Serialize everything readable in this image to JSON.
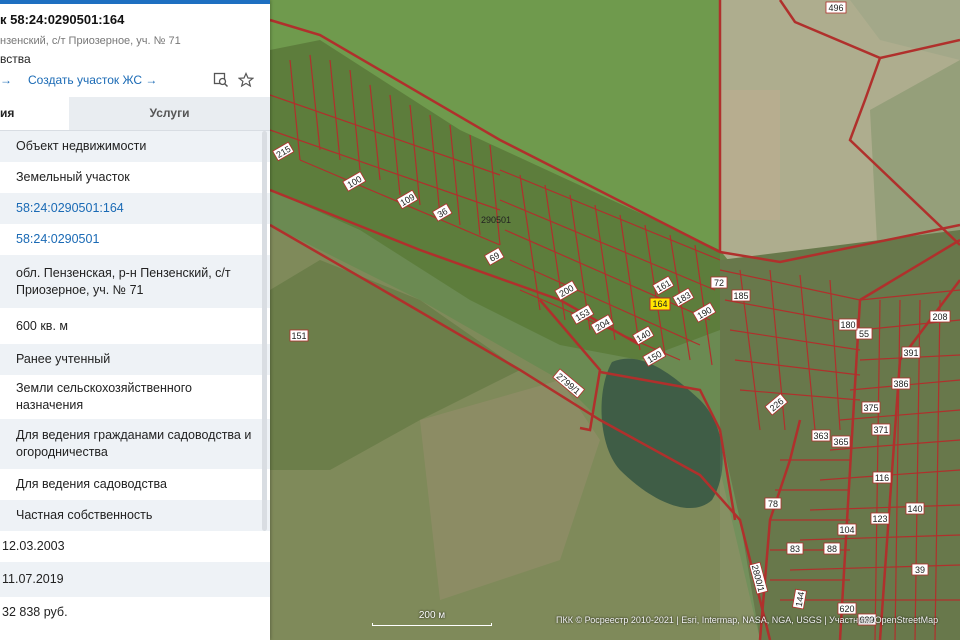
{
  "panel": {
    "title": "к 58:24:0290501:164",
    "subtitle": "нзенский, с/т Приозерное, уч. № 71",
    "category": "вства",
    "link_prefix": "→",
    "create_link": "Создать участок ЖС →",
    "tabs": [
      "ия",
      "Услуги"
    ],
    "rows": [
      "Объект недвижимости",
      "Земельный участок",
      "58:24:0290501:164",
      "58:24:0290501",
      "обл. Пензенская, р-н Пензенский, с/т Приозерное, уч. № 71",
      "600 кв. м",
      "Ранее учтенный",
      "Земли сельскохозяйственного назначения",
      "Для ведения гражданами садоводства и огородничества",
      "Для ведения садоводства",
      "Частная собственность",
      "12.03.2003",
      "11.07.2019",
      "32 838 руб."
    ]
  },
  "map": {
    "labels": [
      "496",
      "151",
      "290501",
      "2799/1",
      "164",
      "72",
      "185",
      "55",
      "180",
      "391",
      "208",
      "375",
      "386",
      "363",
      "365",
      "371",
      "116",
      "123",
      "140",
      "104",
      "88",
      "620",
      "639",
      "39",
      "83",
      "78",
      "2800/1",
      "144",
      "226",
      "215",
      "100",
      "109",
      "36",
      "69",
      "200",
      "153",
      "204",
      "150",
      "161",
      "183",
      "190",
      "140",
      "226"
    ],
    "highlighted_parcel": "164",
    "scale": "200 м",
    "attribution": "ПКК © Росреестр 2010-2021 | Esri, Intermap, NASA, NGA, USGS | Участники OpenStreetMap"
  },
  "colors": {
    "accent": "#1e6fc1",
    "link": "#1a6ab5",
    "boundary": "#b0302c",
    "highlight": "#ffe600"
  }
}
